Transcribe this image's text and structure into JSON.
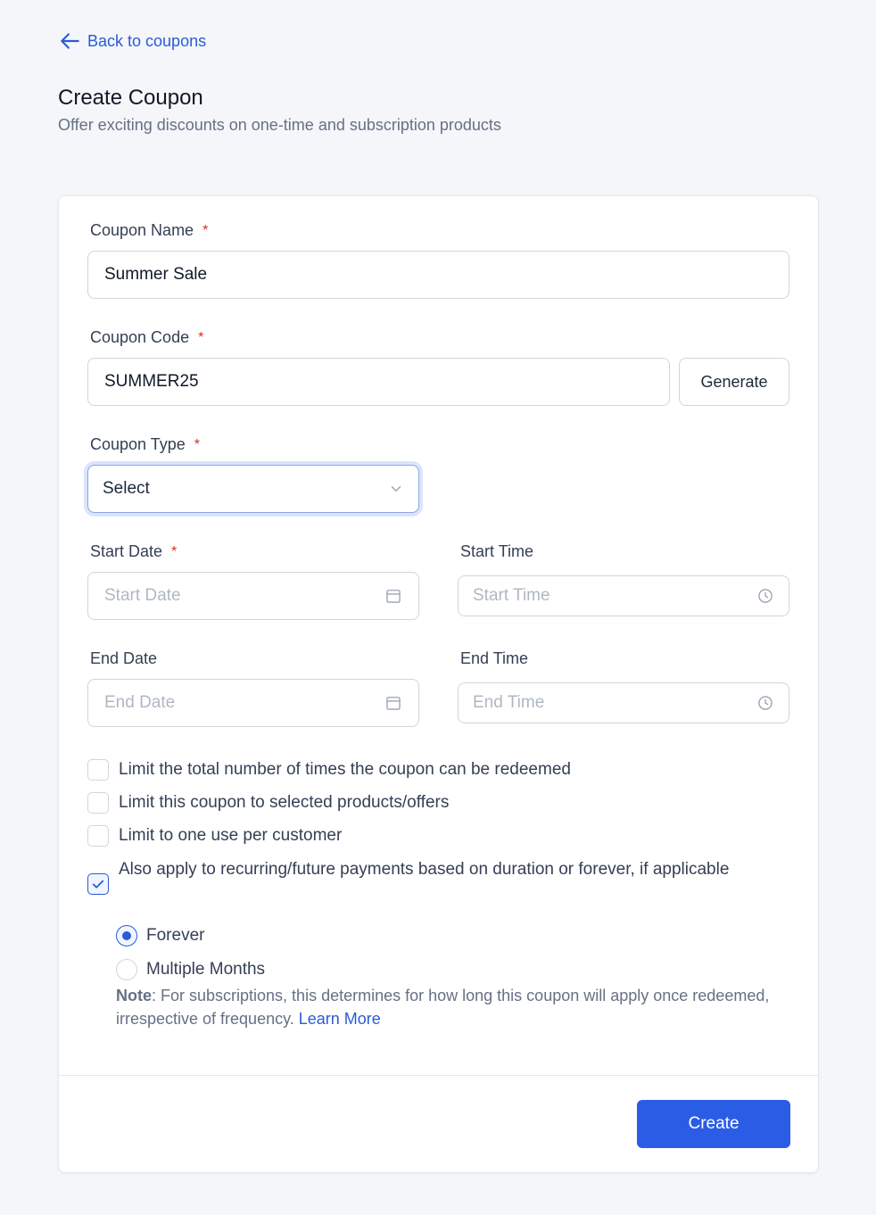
{
  "nav": {
    "back_label": "Back to coupons"
  },
  "header": {
    "title": "Create Coupon",
    "subtitle": "Offer exciting discounts on one-time and subscription products"
  },
  "form": {
    "coupon_name": {
      "label": "Coupon Name",
      "value": "Summer Sale"
    },
    "coupon_code": {
      "label": "Coupon Code",
      "value": "SUMMER25",
      "generate_label": "Generate"
    },
    "coupon_type": {
      "label": "Coupon Type",
      "selected": "Select"
    },
    "start_date": {
      "label": "Start Date",
      "placeholder": "Start Date"
    },
    "start_time": {
      "label": "Start Time",
      "placeholder": "Start Time"
    },
    "end_date": {
      "label": "End Date",
      "placeholder": "End Date"
    },
    "end_time": {
      "label": "End Time",
      "placeholder": "End Time"
    },
    "required_marker": "*"
  },
  "options": [
    {
      "label": "Limit the total number of times the coupon can be redeemed",
      "checked": false
    },
    {
      "label": "Limit this coupon to selected products/offers",
      "checked": false
    },
    {
      "label": "Limit to one use per customer",
      "checked": false
    },
    {
      "label": "Also apply to recurring/future payments based on duration or forever, if applicable",
      "checked": true
    }
  ],
  "duration": {
    "options": [
      {
        "label": "Forever",
        "selected": true
      },
      {
        "label": "Multiple Months",
        "selected": false
      }
    ]
  },
  "note": {
    "prefix": "Note",
    "text": ": For subscriptions, this determines for how long this coupon will apply once redeemed, irrespective of frequency. ",
    "link": "Learn More"
  },
  "footer": {
    "create_label": "Create"
  },
  "colors": {
    "primary": "#2b5ce6",
    "link": "#2a5bd7",
    "required": "#d92d20"
  },
  "icons": [
    "arrow-left-icon",
    "chevron-down-icon",
    "calendar-icon",
    "clock-icon",
    "check-icon"
  ]
}
